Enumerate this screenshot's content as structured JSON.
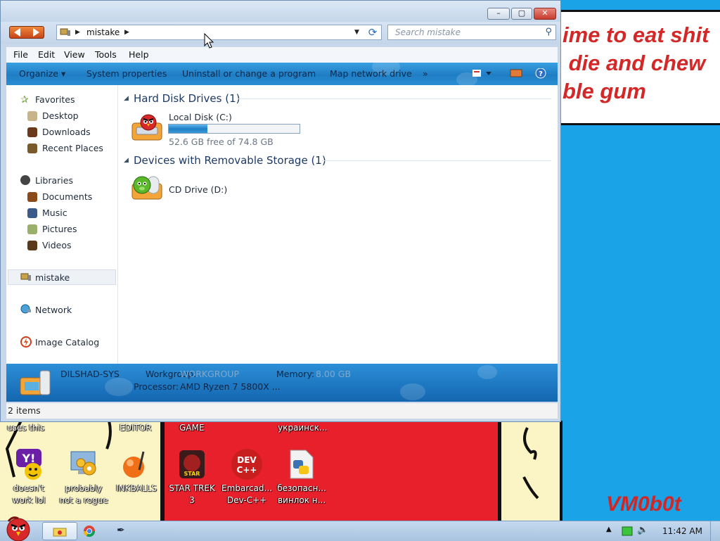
{
  "window": {
    "title_buttons": {
      "minimize": "–",
      "maximize": "▢",
      "close": "✕"
    },
    "address": {
      "crumb": "mistake"
    },
    "search": {
      "placeholder": "Search mistake"
    },
    "menubar": [
      "File",
      "Edit",
      "View",
      "Tools",
      "Help"
    ],
    "commandbar": [
      "Organize ▾",
      "System properties",
      "Uninstall or change a program",
      "Map network drive",
      "»"
    ],
    "navpane": {
      "favorites": {
        "header": "Favorites",
        "items": [
          "Desktop",
          "Downloads",
          "Recent Places"
        ]
      },
      "libraries": {
        "header": "Libraries",
        "items": [
          "Documents",
          "Music",
          "Pictures",
          "Videos"
        ]
      },
      "computer": "mistake",
      "network": "Network",
      "image_catalog": "Image Catalog"
    },
    "content": {
      "groups": [
        {
          "header": "Hard Disk Drives (1)",
          "drive": {
            "label": "Local Disk (C:)",
            "free_text": "52.6 GB free of 74.8 GB",
            "used_fraction": 0.297
          }
        },
        {
          "header": "Devices with Removable Storage (1)",
          "drive": {
            "label": "CD Drive (D:)"
          }
        }
      ]
    },
    "details": {
      "name": "DILSHAD-SYS",
      "workgroup_label": "Workgroup:",
      "workgroup": "WORKGROUP",
      "memory_label": "Memory:",
      "memory": "8.00 GB",
      "processor_label": "Processor:",
      "processor": "AMD Ryzen 7 5800X ..."
    },
    "status": "2 items"
  },
  "desktop": {
    "speech_text": "ime to eat shit\n die and chew\nble gum",
    "signature": "VM0b0t",
    "top_labels": [
      "uses this",
      "EDITOR",
      "GAME",
      "украинск..."
    ],
    "icons": [
      {
        "label": "doesn't\nwork lol",
        "icon": "yahoo-messenger-icon"
      },
      {
        "label": "probably\nnot a rogue",
        "icon": "gears-monitor-icon"
      },
      {
        "label": "INKBALLS",
        "icon": "inkball-icon"
      },
      {
        "label": "STAR TREK\n3",
        "icon": "star-wars-game-icon"
      },
      {
        "label": "Embarcad...\nDev-C++",
        "icon": "devcpp-icon"
      },
      {
        "label": "безопасн...\nвинлок н...",
        "icon": "python-file-icon"
      }
    ]
  },
  "taskbar": {
    "clock": "11:42 AM",
    "tray_icons": [
      "show-hidden-icons",
      "network-icon",
      "volume-icon"
    ]
  },
  "colors": {
    "accent": "#1f7dc4",
    "wallpaper_blue": "#1aa3e6",
    "wallpaper_red": "#e8202c",
    "wallpaper_cream": "#fbf4c4"
  }
}
